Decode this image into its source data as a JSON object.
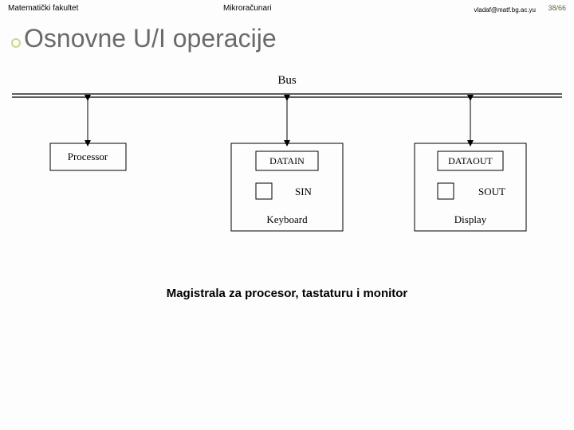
{
  "header": {
    "left": "Matematički fakultet",
    "center": "Mikroračunari",
    "email": "vladaf@matf.bg.ac.yu",
    "page": "38/66"
  },
  "title": "Osnovne U/I operacije",
  "caption": "Magistrala za procesor, tastaturu i monitor",
  "diagram": {
    "bus_label": "Bus",
    "blocks": {
      "processor": "Processor",
      "datain": "DATAIN",
      "dataout": "DATAOUT",
      "sin": "SIN",
      "sout": "SOUT",
      "keyboard": "Keyboard",
      "display": "Display"
    }
  }
}
